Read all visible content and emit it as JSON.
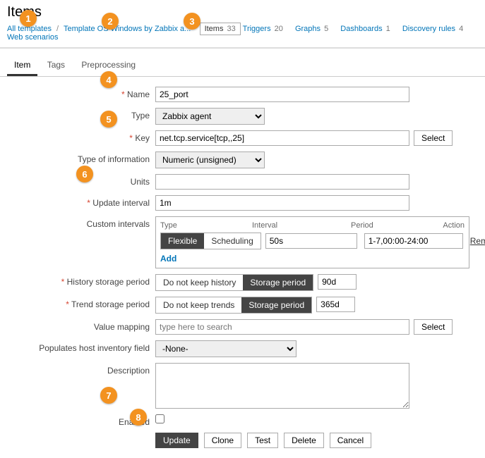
{
  "title": "Items",
  "breadcrumb": {
    "all_templates": "All templates",
    "template": "Template OS Windows by Zabbix a...",
    "items_label": "Items",
    "items_count": "33",
    "triggers_label": "Triggers",
    "triggers_count": "20",
    "graphs_label": "Graphs",
    "graphs_count": "5",
    "dashboards_label": "Dashboards",
    "dashboards_count": "1",
    "discovery_label": "Discovery rules",
    "discovery_count": "4",
    "webscenarios_label": "Web scenarios"
  },
  "tabs": {
    "item": "Item",
    "tags": "Tags",
    "preprocessing": "Preprocessing"
  },
  "labels": {
    "name": "Name",
    "type": "Type",
    "key": "Key",
    "type_of_info": "Type of information",
    "units": "Units",
    "update_interval": "Update interval",
    "custom_intervals": "Custom intervals",
    "history": "History storage period",
    "trend": "Trend storage period",
    "value_mapping": "Value mapping",
    "inventory": "Populates host inventory field",
    "description": "Description",
    "enabled": "Enabled"
  },
  "fields": {
    "name": "25_port",
    "type": "Zabbix agent",
    "key": "net.tcp.service[tcp,,25]",
    "type_of_info": "Numeric (unsigned)",
    "units": "",
    "update_interval": "1m",
    "custom": {
      "head_type": "Type",
      "head_interval": "Interval",
      "head_period": "Period",
      "head_action": "Action",
      "flexible": "Flexible",
      "scheduling": "Scheduling",
      "interval": "50s",
      "period": "1-7,00:00-24:00",
      "remove": "Remove",
      "add": "Add"
    },
    "history_opt1": "Do not keep history",
    "history_opt2": "Storage period",
    "history_val": "90d",
    "trend_opt1": "Do not keep trends",
    "trend_opt2": "Storage period",
    "trend_val": "365d",
    "value_mapping_ph": "type here to search",
    "inventory": "-None-",
    "description": ""
  },
  "buttons": {
    "select": "Select",
    "update": "Update",
    "clone": "Clone",
    "test": "Test",
    "delete": "Delete",
    "cancel": "Cancel"
  },
  "callouts": {
    "c1": "1",
    "c2": "2",
    "c3": "3",
    "c4": "4",
    "c5": "5",
    "c6": "6",
    "c7": "7",
    "c8": "8"
  }
}
